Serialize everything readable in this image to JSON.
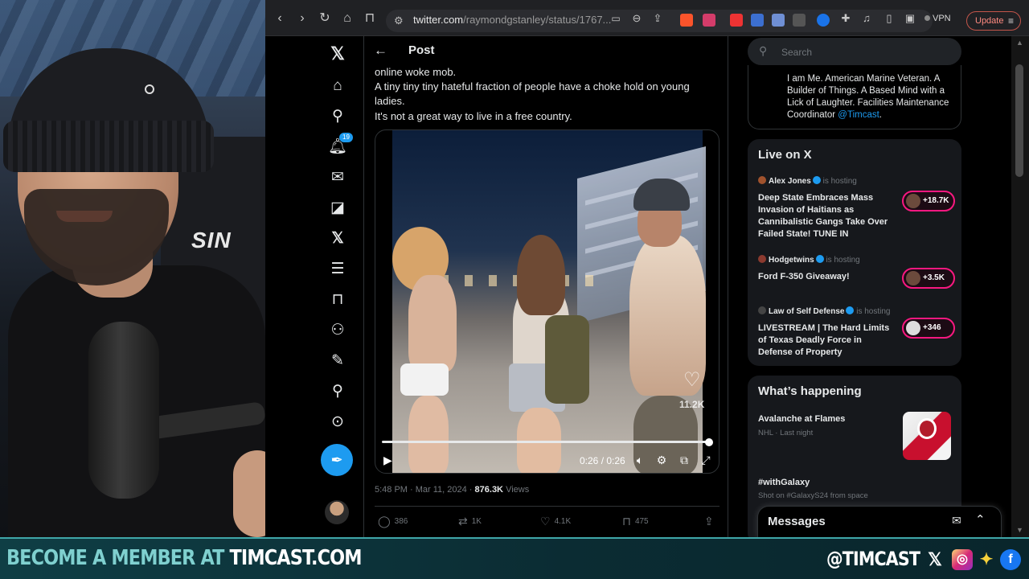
{
  "browser": {
    "url_host": "twitter.com",
    "url_path": "/raymondgstanley/status/1767...",
    "vpn_label": "VPN",
    "update_label": "Update"
  },
  "nav": {
    "notifications_badge": "19"
  },
  "post": {
    "header_title": "Post",
    "text_lines": [
      "online woke mob.",
      "A tiny tiny tiny hateful fraction of people have a choke hold on young ladies.",
      "It's not a great way to live in a free country."
    ],
    "video": {
      "overlay_count": "11.2K",
      "time": "0:26 / 0:26",
      "progress_fraction": 1.0
    },
    "timestamp": "5:48 PM · Mar 11, 2024 · ",
    "views_count": "876.3K",
    "views_label": " Views",
    "actions": {
      "replies": "386",
      "reposts": "1K",
      "likes": "4.1K",
      "bookmarks": "475"
    }
  },
  "sidebar": {
    "search_placeholder": "Search",
    "bio_text": "I am Me. American Marine Veteran. A Builder of Things. A Based Mind with a Lick of Laughter. Facilities Maintenance Coordinator ",
    "bio_link": "@Timcast",
    "bio_end": ".",
    "live": {
      "title": "Live on X",
      "items": [
        {
          "host": "Alex Jones",
          "status": "is hosting",
          "title": "Deep State Embraces Mass Invasion of Haitians as Cannibalistic Gangs Take Over Failed State! TUNE IN",
          "count": "+18.7K"
        },
        {
          "host": "Hodgetwins",
          "status": "is hosting",
          "title": "Ford F-350 Giveaway!",
          "count": "+3.5K"
        },
        {
          "host": "Law of Self Defense",
          "status": "is hosting",
          "title": "LIVESTREAM | The Hard Limits of Texas Deadly Force in Defense of Property",
          "count": "+346"
        }
      ]
    },
    "happening": {
      "title": "What’s happening",
      "items": [
        {
          "label": "Avalanche at Flames",
          "sub": "NHL · Last night"
        },
        {
          "label": "#withGalaxy",
          "sub": "Shot on #GalaxyS24 from space"
        }
      ]
    },
    "messages_label": "Messages"
  },
  "banner": {
    "left_a": "BECOME A MEMBER AT ",
    "left_b": "TIMCAST.COM",
    "handle": "@TIMCAST"
  },
  "colors": {
    "accent": "#1d9bf0",
    "live_pill": "#f91880",
    "banner_bg": "#0f3e45",
    "banner_text_accent": "#7fd0cf"
  },
  "icons": [
    "back-icon",
    "forward-icon",
    "reload-icon",
    "home-icon",
    "bookmark-icon",
    "search-icon",
    "x-logo-icon",
    "notifications-icon",
    "messages-icon",
    "grok-icon",
    "lists-icon",
    "communities-icon",
    "premium-icon",
    "profile-icon",
    "more-icon",
    "compose-icon",
    "play-icon",
    "volume-icon",
    "settings-icon",
    "pip-icon",
    "fullscreen-icon",
    "reply-icon",
    "repost-icon",
    "like-icon",
    "share-icon"
  ]
}
